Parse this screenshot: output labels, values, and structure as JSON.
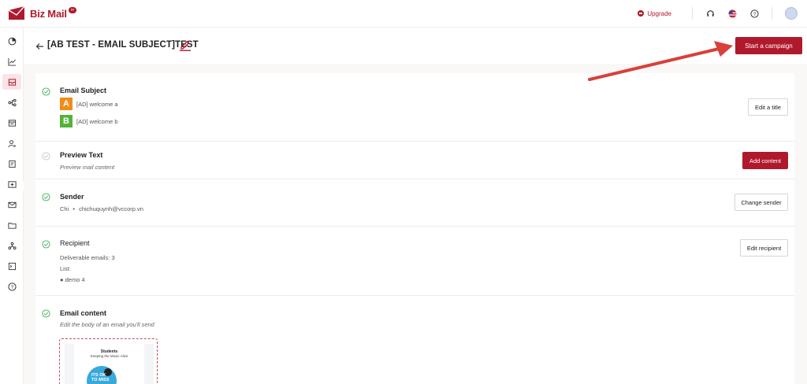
{
  "brand": {
    "name": "Biz Mail",
    "badge": "∞",
    "color": "#b0192c"
  },
  "topbar": {
    "upgrade_label": "Upgrade",
    "icons": [
      "headset-icon",
      "us-flag-icon",
      "help-icon",
      "avatar"
    ]
  },
  "sidebar": {
    "items": [
      {
        "name": "dashboard-icon"
      },
      {
        "name": "reports-icon"
      },
      {
        "name": "campaigns-icon",
        "active": true
      },
      {
        "name": "automation-icon"
      },
      {
        "name": "forms-icon"
      },
      {
        "name": "contacts-icon"
      },
      {
        "name": "templates-icon"
      },
      {
        "name": "landing-icon"
      },
      {
        "name": "mail-icon"
      },
      {
        "name": "folder-icon"
      },
      {
        "name": "integrations-icon"
      },
      {
        "name": "console-icon"
      },
      {
        "name": "help-circle-icon"
      }
    ]
  },
  "header": {
    "title": "[AB TEST - EMAIL SUBJECT]TEST",
    "start_campaign_label": "Start a campaign"
  },
  "sections": {
    "subject": {
      "title": "Email Subject",
      "variant_a_letter": "A",
      "variant_a_text": "[AD] welcome a",
      "variant_b_letter": "B",
      "variant_b_text": "[AD] welcome b",
      "button": "Edit a title",
      "status": "complete"
    },
    "preview": {
      "title": "Preview Text",
      "subtitle": "Preview mail content",
      "button": "Add content",
      "status": "pending"
    },
    "sender": {
      "title": "Sender",
      "name": "Chi",
      "separator": "•",
      "email": "chichuquynh@vccorp.vn",
      "button": "Change sender",
      "status": "complete"
    },
    "recipient": {
      "title": "Recipient",
      "deliverable": "Deliverable emails: 3",
      "list_label": "List:",
      "list_item": "● demo 4",
      "button": "Edit recipient",
      "status": "complete"
    },
    "content": {
      "title": "Email content",
      "subtitle": "Edit the body of an email you'll send",
      "status": "complete",
      "thumbnail": {
        "heading": "Students",
        "subheading": "Keeping the Music Alive",
        "circle_text_1": "ITS OK",
        "circle_text_2": "TO MISS"
      }
    }
  },
  "colors": {
    "accent": "#b0192c",
    "check_green": "#3fae5a",
    "check_grey": "#c7c7c7",
    "variant_a": "#f08c1a",
    "variant_b": "#54b13a",
    "annotation_arrow": "#d9403a"
  }
}
